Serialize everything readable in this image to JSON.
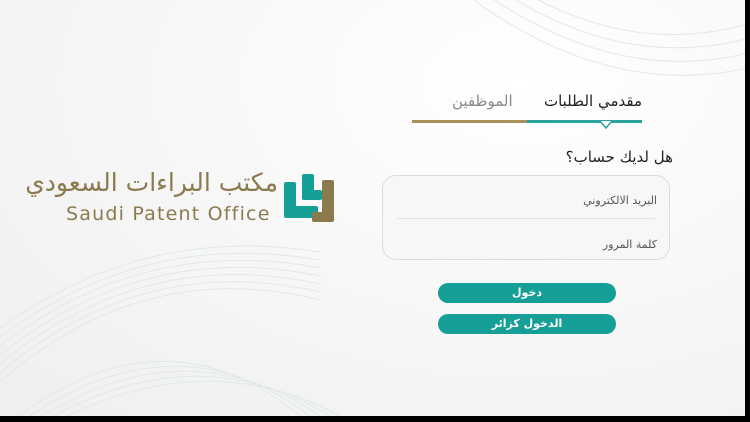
{
  "logo": {
    "arabic_name": "مكتب البراءات السعودي",
    "english_name": "Saudi Patent Office",
    "colors": {
      "teal": "#169f96",
      "gold": "#8b7a4e"
    }
  },
  "tabs": {
    "applicants_label": "مقدمي الطلبات",
    "employees_label": "الموظفين",
    "active": "applicants"
  },
  "login": {
    "question": "هل لديك حساب؟",
    "email_placeholder": "البريد الالكتروني",
    "password_placeholder": "كلمة المرور",
    "login_button": "دخول",
    "guest_button": "الدخول كزائر"
  },
  "theme": {
    "accent": "#169f96",
    "gold": "#a8905a",
    "background": "#f6f6f6"
  }
}
